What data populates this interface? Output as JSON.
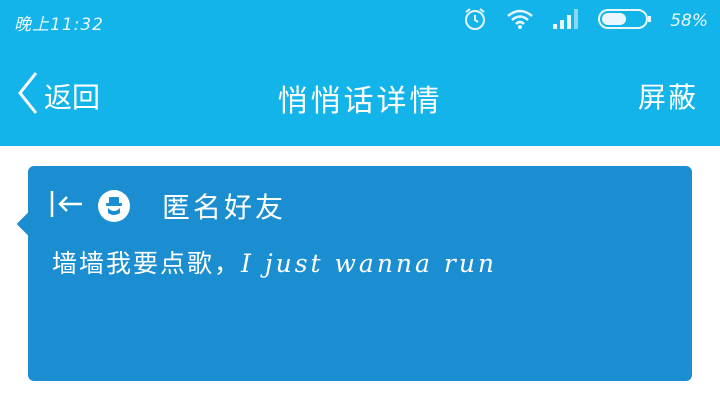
{
  "status_bar": {
    "time": "晚上11:32",
    "battery_percent": "58%",
    "battery_level": 0.58,
    "icons": [
      "alarm-icon",
      "wifi-icon",
      "signal-icon",
      "battery-icon"
    ]
  },
  "nav": {
    "back_label": "返回",
    "title": "悄悄话详情",
    "action_label": "屏蔽"
  },
  "message_card": {
    "sender_name": "匿名好友",
    "text_cn": "墙墙我要点歌，",
    "text_en": "I just wanna run"
  },
  "colors": {
    "header_bg": "#13b4ea",
    "card_bg": "#1a8ed0",
    "page_bg": "#ffffff"
  }
}
